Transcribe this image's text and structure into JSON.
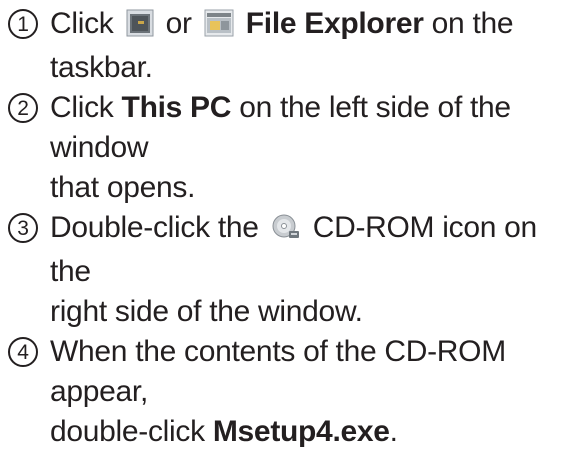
{
  "steps": [
    {
      "number": "1",
      "parts": {
        "a": "Click",
        "icon1": "folder-icon",
        "b": "or",
        "icon2": "file-explorer-icon",
        "bold": "File Explorer",
        "c": "on the",
        "line2": "taskbar."
      }
    },
    {
      "number": "2",
      "parts": {
        "a": "Click",
        "bold": "This PC",
        "b": "on the left side of the window",
        "line2": "that opens."
      }
    },
    {
      "number": "3",
      "parts": {
        "a": "Double-click the",
        "icon": "cd-rom-icon",
        "b": "CD-ROM icon on the",
        "line2": "right side of the window."
      }
    },
    {
      "number": "4",
      "parts": {
        "a": "When the contents of the CD-ROM appear,",
        "line2a": "double-click",
        "bold": "Msetup4.exe",
        "line2b": "."
      }
    }
  ]
}
